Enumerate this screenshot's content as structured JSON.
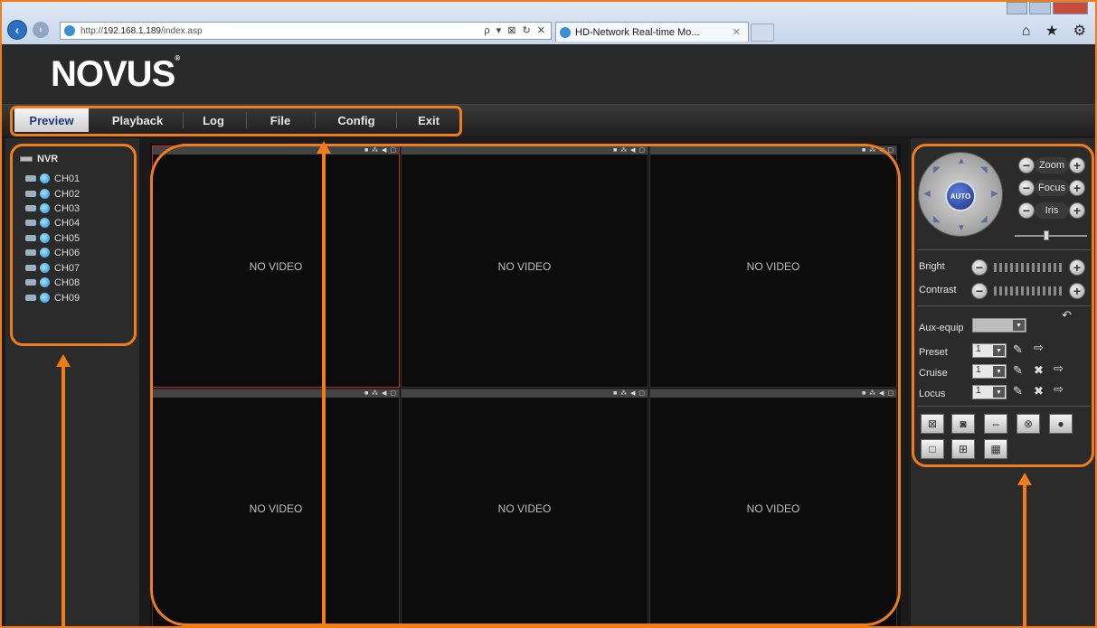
{
  "browser": {
    "address_prefix": "http://",
    "address_host": "192.168.1.189",
    "address_path": "/index.asp",
    "address_tools": "ρ ▾ ⊠ ↻ ✕",
    "tab_title": "HD-Network Real-time Mo...",
    "tab_close": "✕",
    "toolbar_icons": "⌂ ★ ⚙"
  },
  "app": {
    "logo": "NOVUS",
    "logo_mark": "®"
  },
  "menu": [
    {
      "label": "Preview",
      "active": true
    },
    {
      "label": "Playback",
      "active": false
    },
    {
      "label": "Log",
      "active": false
    },
    {
      "label": "File",
      "active": false
    },
    {
      "label": "Config",
      "active": false
    },
    {
      "label": "Exit",
      "active": false
    }
  ],
  "device_tree": {
    "root": "NVR",
    "channels": [
      "CH01",
      "CH02",
      "CH03",
      "CH04",
      "CH05",
      "CH06",
      "CH07",
      "CH08",
      "CH09"
    ]
  },
  "video": {
    "cells": [
      "NO VIDEO",
      "NO VIDEO",
      "NO VIDEO",
      "NO VIDEO",
      "NO VIDEO",
      "NO VIDEO"
    ],
    "cell_icons": "■ ⁂ ◀ ▢"
  },
  "ptz": {
    "auto_label": "AUTO",
    "zoom_label": "Zoom",
    "focus_label": "Focus",
    "iris_label": "Iris",
    "bright_label": "Bright",
    "contrast_label": "Contrast",
    "aux_label": "Aux-equip",
    "preset_label": "Preset",
    "cruise_label": "Cruise",
    "locus_label": "Locus",
    "preset_value": "1",
    "cruise_value": "1",
    "locus_value": "1",
    "minus": "−",
    "plus": "+"
  },
  "colors": {
    "highlight": "#f07d1c",
    "selected_cell_border": "#c1272d",
    "active_tab_text": "#1d3b7a"
  }
}
